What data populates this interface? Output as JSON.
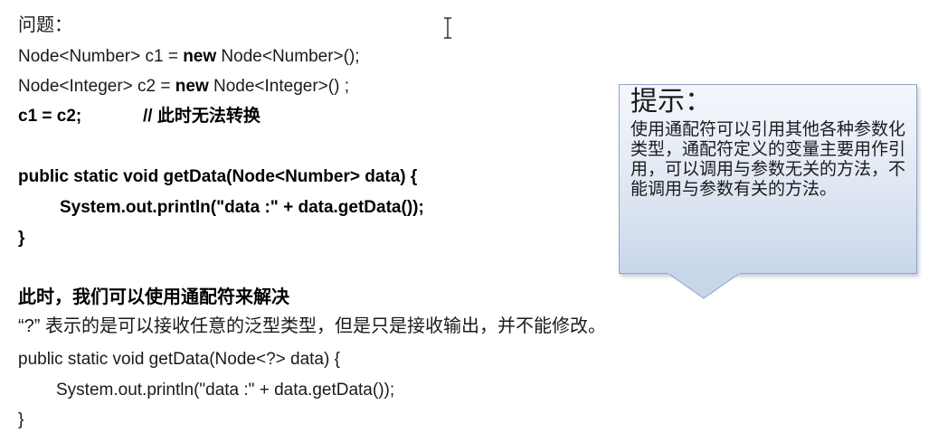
{
  "heading": "问题：",
  "code1": {
    "line1_a": "Node<Number> c1 = ",
    "line1_kw": "new",
    "line1_b": " Node<Number>();",
    "line2_a": "Node<Integer> c2 = ",
    "line2_kw": "new",
    "line2_b": " Node<Integer>() ;",
    "line3_code": "c1 = c2;",
    "line3_comment": "// 此时无法转换"
  },
  "code2": {
    "line1": "public static void getData(Node<Number> data) {",
    "line2": "System.out.println(\"data :\" + data.getData());",
    "line3": "}"
  },
  "solution_heading": "此时，我们可以使用通配符来解决",
  "explanation": "“?” 表示的是可以接收任意的泛型类型，但是只是接收输出，并不能修改。",
  "code3": {
    "line1": "public static void getData(Node<?> data) {",
    "line2": "System.out.println(\"data :\" + data.getData());",
    "line3": "}"
  },
  "callout": {
    "title": "提示：",
    "body": "使用通配符可以引用其他各种参数化类型，通配符定义的变量主要用作引用，可以调用与参数无关的方法，不能调用与参数有关的方法。"
  }
}
